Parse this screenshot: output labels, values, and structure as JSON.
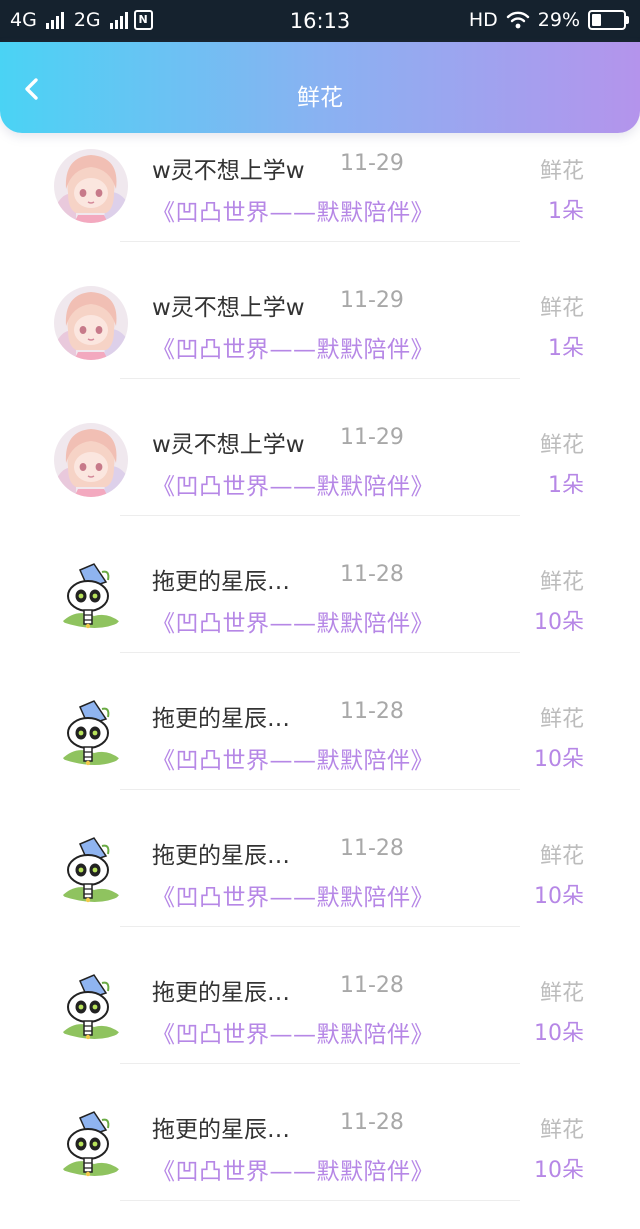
{
  "status_bar": {
    "network1": "4G",
    "network2": "2G",
    "time": "16:13",
    "hd": "HD",
    "battery": "29%",
    "battery_level": 0.29
  },
  "header": {
    "title": "鲜花",
    "gradient_start": "#4ad3f4",
    "gradient_end": "#b494ec"
  },
  "records": [
    {
      "avatar": "anime-girl-avatar",
      "name": "w灵不想上学w",
      "date": "11-29",
      "work": "《凹凸世界——默默陪伴》",
      "gift": "鲜花",
      "count": "1朵"
    },
    {
      "avatar": "anime-girl-avatar",
      "name": "w灵不想上学w",
      "date": "11-29",
      "work": "《凹凸世界——默默陪伴》",
      "gift": "鲜花",
      "count": "1朵"
    },
    {
      "avatar": "anime-girl-avatar",
      "name": "w灵不想上学w",
      "date": "11-29",
      "work": "《凹凸世界——默默陪伴》",
      "gift": "鲜花",
      "count": "1朵"
    },
    {
      "avatar": "skeleton-mascot-avatar",
      "name": "拖更的星辰…",
      "date": "11-28",
      "work": "《凹凸世界——默默陪伴》",
      "gift": "鲜花",
      "count": "10朵"
    },
    {
      "avatar": "skeleton-mascot-avatar",
      "name": "拖更的星辰…",
      "date": "11-28",
      "work": "《凹凸世界——默默陪伴》",
      "gift": "鲜花",
      "count": "10朵"
    },
    {
      "avatar": "skeleton-mascot-avatar",
      "name": "拖更的星辰…",
      "date": "11-28",
      "work": "《凹凸世界——默默陪伴》",
      "gift": "鲜花",
      "count": "10朵"
    },
    {
      "avatar": "skeleton-mascot-avatar",
      "name": "拖更的星辰…",
      "date": "11-28",
      "work": "《凹凸世界——默默陪伴》",
      "gift": "鲜花",
      "count": "10朵"
    },
    {
      "avatar": "skeleton-mascot-avatar",
      "name": "拖更的星辰…",
      "date": "11-28",
      "work": "《凹凸世界——默默陪伴》",
      "gift": "鲜花",
      "count": "10朵"
    }
  ],
  "colors": {
    "accent": "#b687e6",
    "muted": "#bcbcbc"
  }
}
